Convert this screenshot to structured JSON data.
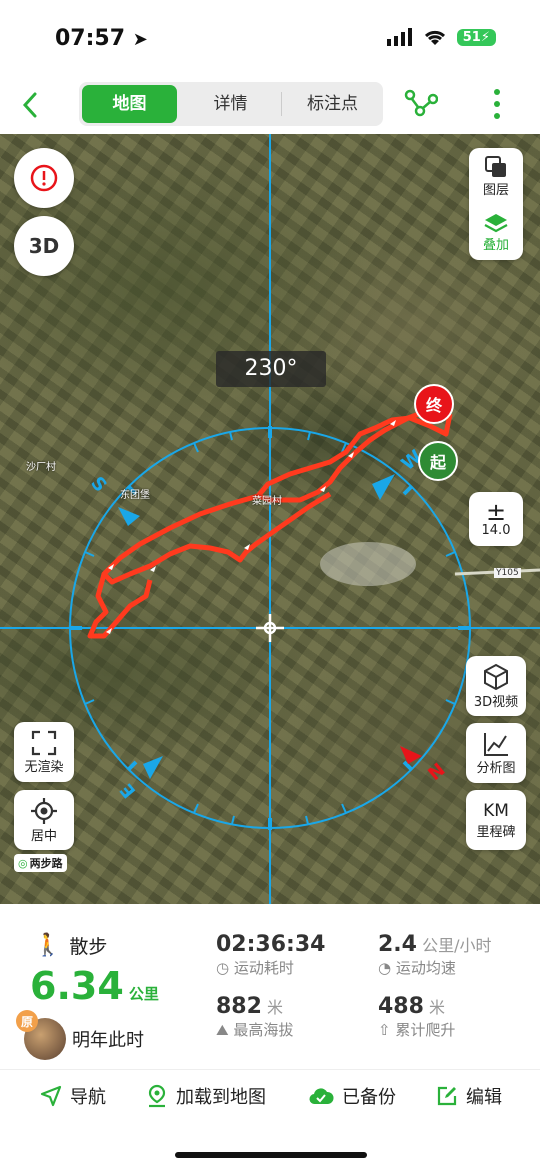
{
  "status_bar": {
    "time": "07:57",
    "battery": "51"
  },
  "header": {
    "tabs": [
      {
        "label": "地图"
      },
      {
        "label": "详情"
      },
      {
        "label": "标注点"
      }
    ]
  },
  "map": {
    "bearing": "230°",
    "layers_label": "图层",
    "overlay_label": "叠加",
    "zoom_level": "14.0",
    "video_label": "3D视频",
    "analysis_label": "分析图",
    "km_title": "KM",
    "km_label": "里程碑",
    "no_render_label": "无渲染",
    "center_label": "居中",
    "logo_text": "两步路",
    "btn_3d_text": "3D",
    "end_marker": "终",
    "start_marker": "起",
    "road_label": "Y105",
    "compass": {
      "s": "S",
      "w": "W",
      "n": "N",
      "e": "E"
    },
    "place_labels": [
      {
        "text": "沙厂村"
      },
      {
        "text": "东团堡"
      },
      {
        "text": "菜园村"
      }
    ]
  },
  "stats": {
    "activity_type": "散步",
    "distance_value": "6.34",
    "distance_unit": "公里",
    "duration_value": "02:36:34",
    "duration_label": "运动耗时",
    "speed_value": "2.4",
    "speed_unit": "公里/小时",
    "speed_label": "运动均速",
    "altitude_value": "882",
    "altitude_unit": "米",
    "altitude_label": "最高海拔",
    "climb_value": "488",
    "climb_unit": "米",
    "climb_label": "累计爬升",
    "badge": "原",
    "memory_text": "明年此时"
  },
  "bottom_bar": {
    "navigate": "导航",
    "load_map": "加载到地图",
    "backed_up": "已备份",
    "edit": "编辑"
  },
  "colors": {
    "accent": "#2ab13a",
    "track": "#ff3a1e",
    "compass": "#1aa7e8",
    "end": "#e8141a",
    "start": "#2e8b34"
  }
}
